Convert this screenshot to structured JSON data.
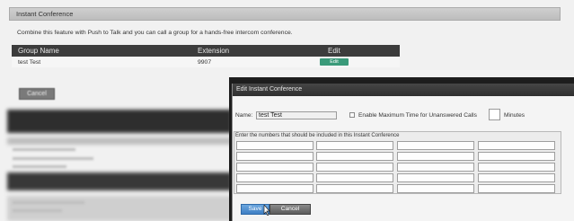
{
  "page": {
    "header_title": "Instant Conference",
    "description": "Combine this feature with Push to Talk and you can call a group for a hands-free intercom conference.",
    "table": {
      "columns": [
        "Group Name",
        "Extension",
        "Edit"
      ],
      "rows": [
        {
          "group_name": "test Test",
          "extension": "9907",
          "edit_label": "Edit"
        }
      ]
    },
    "cancel_label": "Cancel"
  },
  "dialog": {
    "title": "Edit Instant Conference",
    "name_label": "Name:",
    "name_value": "test Test",
    "enable_max_time_label": "Enable Maximum Time for Unanswered Calls",
    "minutes_label": "Minutes",
    "numbers_label": "Enter the numbers that should be included in this Instant Conference",
    "save_label": "Save",
    "cancel_label": "Cancel"
  }
}
